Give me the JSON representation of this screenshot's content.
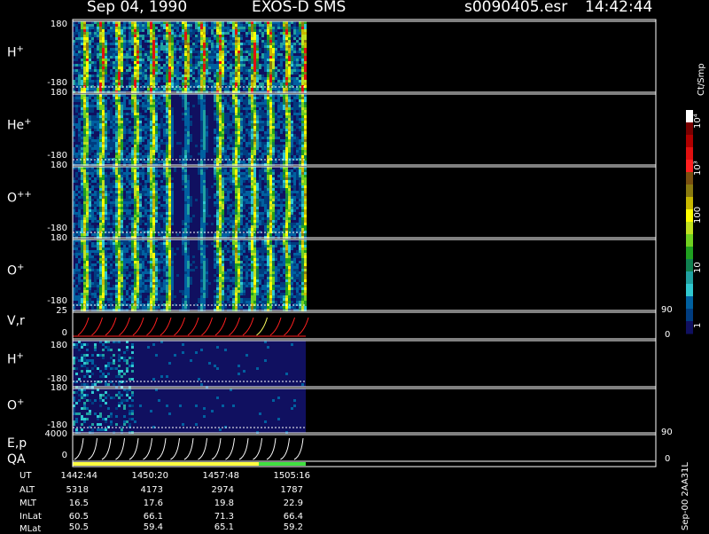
{
  "header": {
    "date": "Sep 04, 1990",
    "mission": "EXOS-D SMS",
    "file": "s0090405.esr",
    "time": "14:42:44"
  },
  "colorbar": {
    "units": "Ct/Smp",
    "labels": [
      "10⁴",
      "10³",
      "100",
      "10",
      "1"
    ],
    "colors": [
      "#ffffff",
      "#7a0000",
      "#b00000",
      "#e01010",
      "#ff2020",
      "#7a5010",
      "#8a7a10",
      "#c8b800",
      "#ffff00",
      "#c0e020",
      "#70d020",
      "#20a020",
      "#108050",
      "#20a0a0",
      "#30c8d0",
      "#0060a0",
      "#003c80",
      "#101060"
    ]
  },
  "panels": [
    {
      "id": "h-plus",
      "label": "H",
      "sup": "+",
      "ymax": "180",
      "ymin": "-180",
      "type": "spectrogram"
    },
    {
      "id": "he-plus",
      "label": "He",
      "sup": "+",
      "ymax": "180",
      "ymin": "-180",
      "type": "spectrogram"
    },
    {
      "id": "o-plusplus",
      "label": "O",
      "sup": "++",
      "ymax": "180",
      "ymin": "-180",
      "type": "spectrogram"
    },
    {
      "id": "o-plus",
      "label": "O",
      "sup": "+",
      "ymax": "180",
      "ymin": "-180",
      "type": "spectrogram"
    },
    {
      "id": "v-r",
      "label": "V,r",
      "sup": "",
      "ymax": "25",
      "ymin": "0",
      "rmax": "90",
      "rmin": "0",
      "type": "line"
    },
    {
      "id": "h-plus-2",
      "label": "H",
      "sup": "+",
      "ymax": "180",
      "ymin": "-180",
      "type": "spectrogram-sparse"
    },
    {
      "id": "o-plus-2",
      "label": "O",
      "sup": "+",
      "ymax": "180",
      "ymin": "-180",
      "type": "spectrogram-sparse"
    },
    {
      "id": "e-p",
      "label": "E,p",
      "sup": "",
      "ymax": "4000",
      "ymin": "0",
      "rmax": "90",
      "rmin": "0",
      "type": "line"
    }
  ],
  "qa_label": "QA",
  "footer": {
    "rows": [
      {
        "label": "UT",
        "values": [
          "1442:44",
          "1450:20",
          "1457:48",
          "1505:16"
        ]
      },
      {
        "label": "ALT",
        "values": [
          "5318",
          "4173",
          "2974",
          "1787"
        ]
      },
      {
        "label": "MLT",
        "values": [
          "16.5",
          "17.6",
          "19.8",
          "22.9"
        ]
      },
      {
        "label": "InLat",
        "values": [
          "60.5",
          "66.1",
          "71.3",
          "66.4"
        ]
      },
      {
        "label": "MLat",
        "values": [
          "50.5",
          "59.4",
          "65.1",
          "59.2"
        ]
      }
    ]
  },
  "side_note": "Sep-00  2AA31L",
  "chart_data": {
    "type": "heatmap",
    "title": "Sep 04, 1990   EXOS-D SMS",
    "x_ticks": [
      "1442:44",
      "1450:20",
      "1457:48",
      "1505:16"
    ],
    "series": [
      {
        "name": "H+",
        "ylim": [
          -180,
          180
        ]
      },
      {
        "name": "He+",
        "ylim": [
          -180,
          180
        ]
      },
      {
        "name": "O++",
        "ylim": [
          -180,
          180
        ]
      },
      {
        "name": "O+",
        "ylim": [
          -180,
          180
        ]
      },
      {
        "name": "V,r",
        "ylim": [
          0,
          25
        ],
        "right_ylim": [
          0,
          90
        ]
      },
      {
        "name": "H+",
        "ylim": [
          -180,
          180
        ]
      },
      {
        "name": "O+",
        "ylim": [
          -180,
          180
        ]
      },
      {
        "name": "E,p",
        "ylim": [
          0,
          4000
        ],
        "right_ylim": [
          0,
          90
        ]
      }
    ],
    "colorbar_units": "Ct/Smp",
    "colorbar_scale": "log",
    "colorbar_range": [
      1,
      10000
    ]
  }
}
